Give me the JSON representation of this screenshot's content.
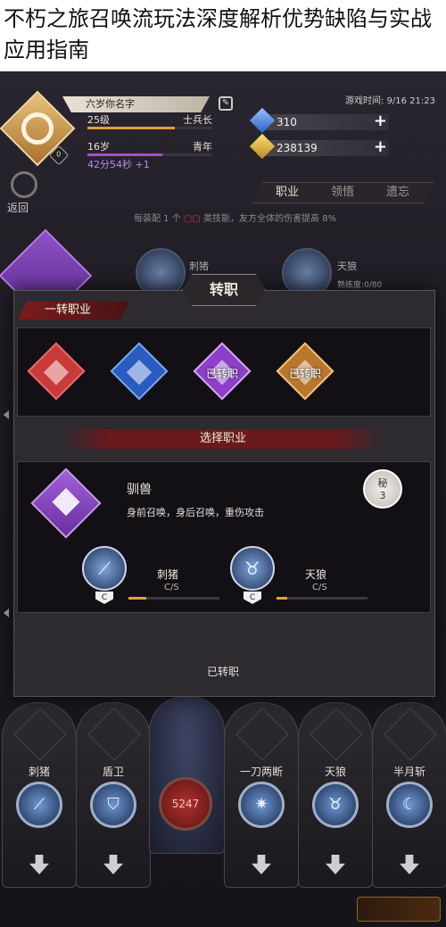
{
  "article": {
    "title": "不朽之旅召唤流玩法深度解析优势缺陷与实战应用指南"
  },
  "player": {
    "name": "六岁你名字",
    "level": "25级",
    "rank": "士兵长",
    "age": "16岁",
    "stage": "青年",
    "timer": "42分54秒 +1",
    "avatar_badge": "0",
    "level_progress": 0.7,
    "age_progress": 0.6
  },
  "header": {
    "game_time": "游戏时间: 9/16 21:23",
    "diamonds": "310",
    "gold": "238139",
    "back_label": "返回"
  },
  "tabs": [
    {
      "label": "职业",
      "active": true
    },
    {
      "label": "领悟",
      "active": false
    },
    {
      "label": "遗忘",
      "active": false
    }
  ],
  "hint": {
    "pre": "每装配 1 个",
    "mid": "类技能，友方全体的伤害提高",
    "pct": "8%"
  },
  "background_skills": [
    {
      "name": "刺猪"
    },
    {
      "name": "天狼",
      "sub": "熟练度:0/80"
    }
  ],
  "dialog": {
    "title": "转职",
    "section_label": "一转职业",
    "select_label": "选择职业",
    "classes": [
      {
        "color": "#c93a3a",
        "border": "#e46b6b",
        "label": ""
      },
      {
        "color": "#2a5cc0",
        "border": "#7aa6ee",
        "label": ""
      },
      {
        "color": "#8c40c8",
        "border": "#d6a8f2",
        "label": "已转职"
      },
      {
        "color": "#b9772e",
        "border": "#f0c47a",
        "label": "已转职"
      }
    ],
    "detail": {
      "name": "驯兽",
      "desc": "身前召唤，身后召唤，重伤攻击",
      "secret_label": "秘",
      "secret_num": "3"
    },
    "skills": [
      {
        "name": "刺猪",
        "grade": "C",
        "cs": "C/S",
        "progress": 0.2
      },
      {
        "name": "天狼",
        "grade": "C",
        "cs": "C/S",
        "progress": 0.12
      }
    ],
    "status_label": "已转职"
  },
  "bottom_slots": [
    {
      "name": "刺猪",
      "icon": "claw-icon"
    },
    {
      "name": "盾卫",
      "icon": "shield-icon"
    },
    {
      "name": "",
      "icon": "orb-icon",
      "value": "5247"
    },
    {
      "name": "一刀两断",
      "icon": "slash-icon"
    },
    {
      "name": "天狼",
      "icon": "wolf-icon"
    },
    {
      "name": "半月斩",
      "icon": "crescent-icon"
    }
  ]
}
